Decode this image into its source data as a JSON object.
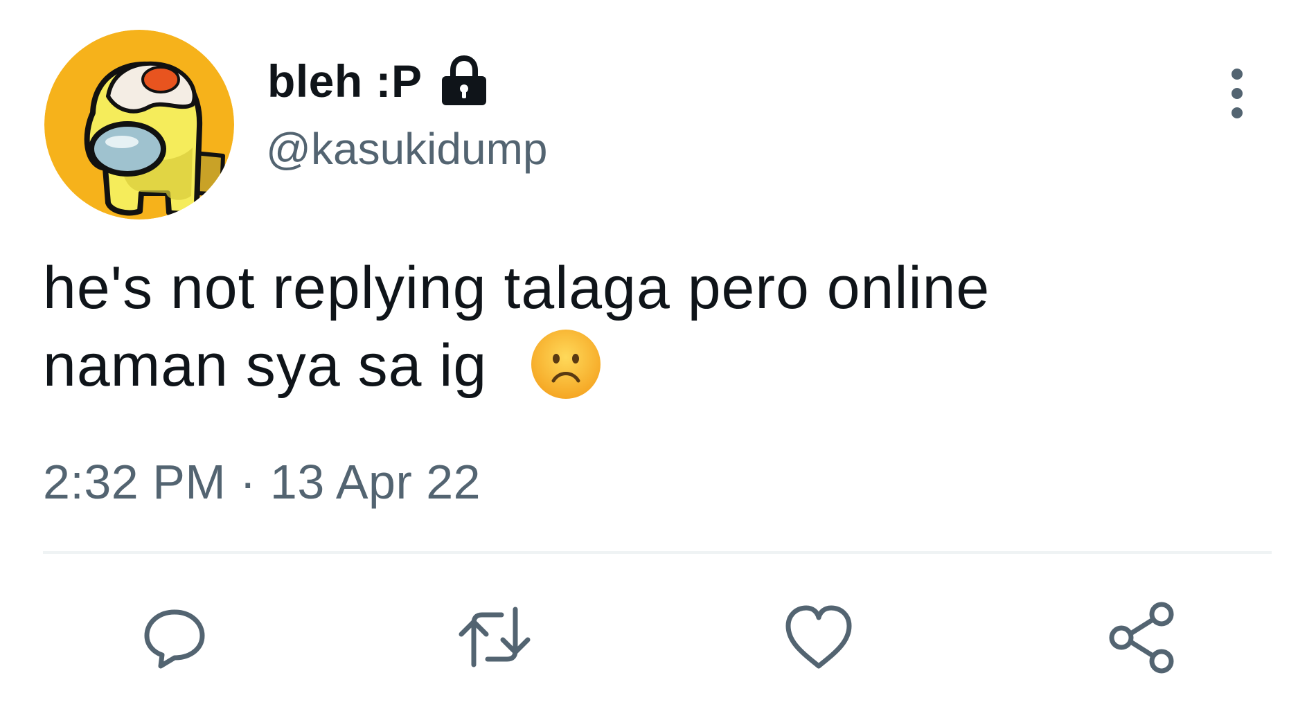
{
  "tweet": {
    "display_name": "bleh :P",
    "handle": "@kasukidump",
    "protected_icon": "lock-icon",
    "text_lines": [
      "he's not replying talaga pero online",
      "naman sya sa ig"
    ],
    "emoji": "frowning-face-emoji",
    "time": "2:32 PM",
    "separator": "·",
    "date": "13 Apr 22"
  },
  "actions": [
    {
      "name": "reply",
      "icon": "reply-icon"
    },
    {
      "name": "retweet",
      "icon": "retweet-icon"
    },
    {
      "name": "like",
      "icon": "heart-icon"
    },
    {
      "name": "share",
      "icon": "share-icon"
    }
  ],
  "colors": {
    "text": "#0f1419",
    "secondary": "#536471",
    "divider": "#eff3f4",
    "avatar_bg": "#f6b21b",
    "crewmate": "#f5ec5b"
  }
}
